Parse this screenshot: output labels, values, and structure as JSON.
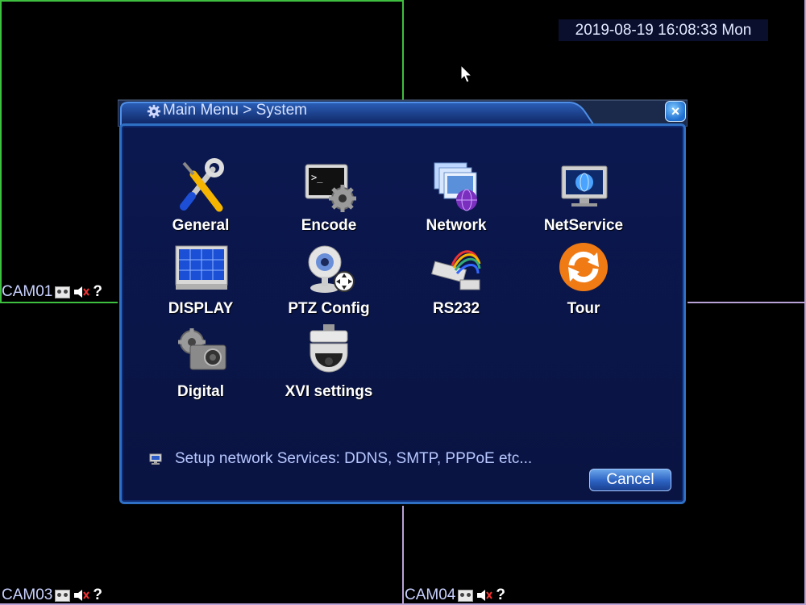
{
  "datetime": "2019-08-19 16:08:33 Mon",
  "cameras": [
    {
      "label": "CAM01"
    },
    {
      "label": "CAM03"
    },
    {
      "label": "CAM04"
    }
  ],
  "cam_status_icons": [
    "record-icon",
    "mute-icon",
    "help-icon"
  ],
  "help_glyph": "?",
  "dialog": {
    "breadcrumb": "Main Menu > System",
    "close_glyph": "×",
    "items": [
      {
        "label": "General",
        "icon": "tools-icon"
      },
      {
        "label": "Encode",
        "icon": "terminal-gear-icon"
      },
      {
        "label": "Network",
        "icon": "network-monitor-icon"
      },
      {
        "label": "NetService",
        "icon": "globe-monitor-icon"
      },
      {
        "label": "DISPLAY",
        "icon": "display-grid-icon"
      },
      {
        "label": "PTZ Config",
        "icon": "webcam-ptz-icon"
      },
      {
        "label": "RS232",
        "icon": "serial-cable-icon"
      },
      {
        "label": "Tour",
        "icon": "refresh-icon"
      },
      {
        "label": "Digital",
        "icon": "digital-camera-icon"
      },
      {
        "label": "XVI settings",
        "icon": "dome-camera-icon"
      }
    ],
    "hint": "Setup network Services: DDNS, SMTP, PPPoE etc...",
    "cancel_label": "Cancel"
  },
  "colors": {
    "grid_green": "#3fbf3f",
    "grid_purple": "#b9a3d6",
    "panel_bg": "#0b1850",
    "panel_border": "#2f6fc4",
    "label_blue": "#c9d2ff"
  }
}
